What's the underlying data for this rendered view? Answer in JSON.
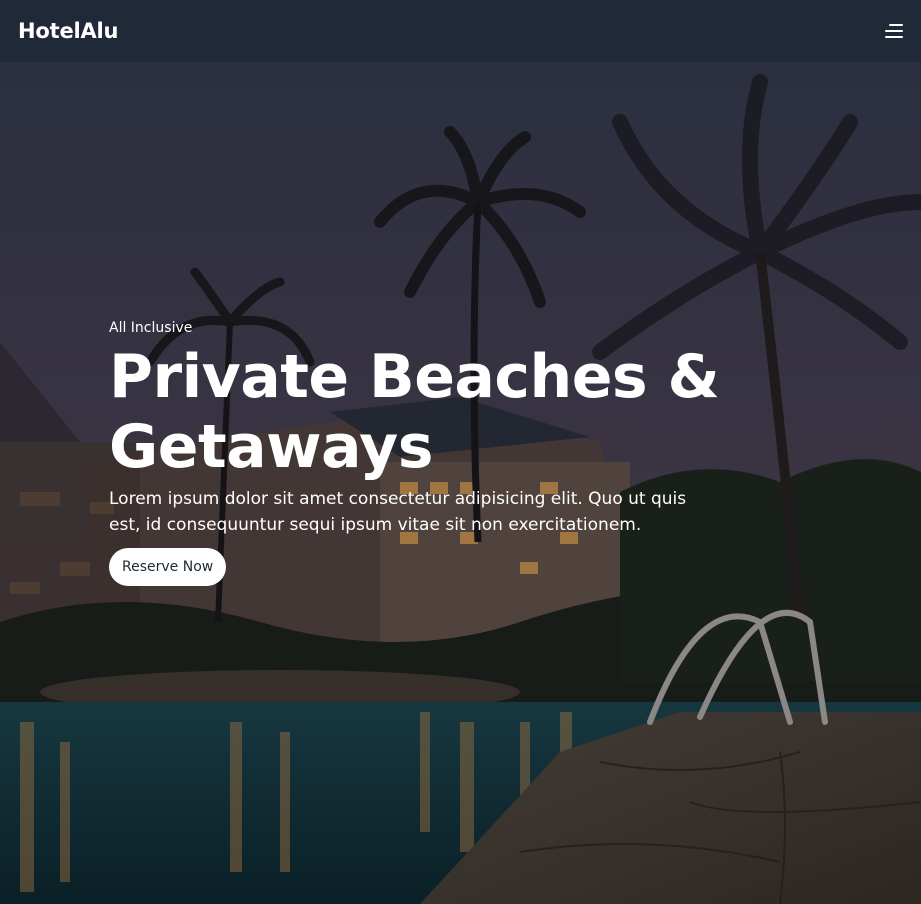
{
  "navbar": {
    "brand": "HotelAlu",
    "menu_icon": "hamburger-menu-icon"
  },
  "hero": {
    "kicker": "All Inclusive",
    "headline": "Private Beaches & Getaways",
    "description": "Lorem ipsum dolor sit amet consectetur adipisicing elit. Quo ut quis est, id consequuntur sequi ipsum vitae sit non exercitationem.",
    "cta_label": "Reserve Now"
  },
  "colors": {
    "navbar_bg": "#1f2937",
    "text": "#ffffff",
    "button_bg": "#ffffff",
    "button_text": "#1f2937"
  }
}
